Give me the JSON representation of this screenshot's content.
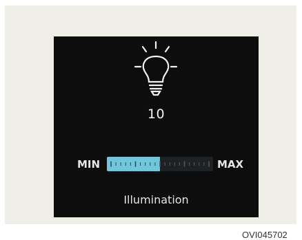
{
  "illumination": {
    "value": "10",
    "min_label": "MIN",
    "max_label": "MAX",
    "caption": "Illumination",
    "level_fraction": 0.5,
    "bulb_icon": "light-bulb-icon",
    "colors": {
      "fill": "#6fc7d9",
      "track": "#1f2224",
      "screen": "#0d0d0d"
    }
  },
  "figure_code": "OVI045702"
}
